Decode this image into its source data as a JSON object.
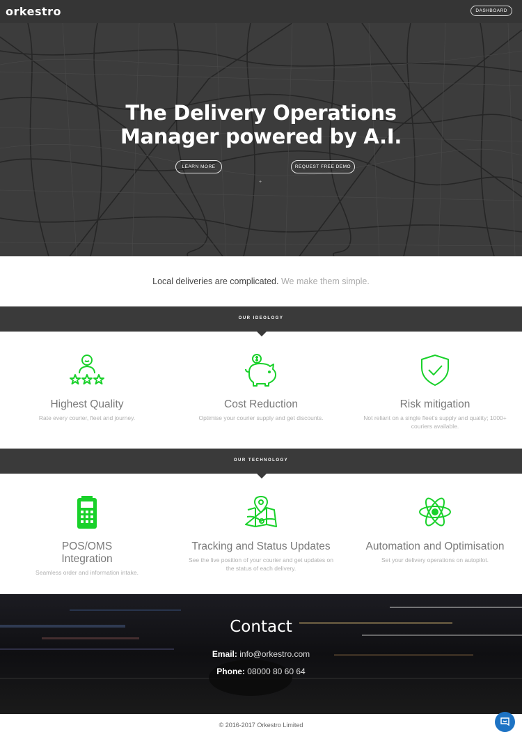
{
  "nav": {
    "logo": "orkestro",
    "dashboard_label": "DASHBOARD"
  },
  "hero": {
    "title_line1": "The Delivery Operations",
    "title_line2": "Manager powered by A.I.",
    "learn_more_label": "LEARN MORE",
    "demo_label": "REQUEST FREE DEMO",
    "dot": "+"
  },
  "tagline": {
    "dark": "Local deliveries are complicated.",
    "light": "We make them simple."
  },
  "ideology": {
    "label": "OUR IDEOLOGY",
    "items": [
      {
        "title": "Highest Quality",
        "desc": "Rate every courier, fleet and journey.",
        "icon": "courier-rating-icon"
      },
      {
        "title": "Cost Reduction",
        "desc": "Optimise your courier supply and get discounts.",
        "icon": "piggy-bank-icon"
      },
      {
        "title": "Risk mitigation",
        "desc": "Not reliant on a single fleet's supply and quality; 1000+ couriers available.",
        "icon": "shield-check-icon"
      }
    ]
  },
  "technology": {
    "label": "OUR TECHNOLOGY",
    "items": [
      {
        "title": "POS/OMS Integration",
        "desc": "Seamless order and information intake.",
        "icon": "pos-terminal-icon"
      },
      {
        "title": "Tracking and Status Updates",
        "desc": "See the live position of your courier and get updates on the status of each delivery.",
        "icon": "map-pin-icon"
      },
      {
        "title": "Automation and Optimisation",
        "desc": "Set your delivery operations on autopilot.",
        "icon": "atom-icon"
      }
    ]
  },
  "contact": {
    "title": "Contact",
    "email_label": "Email:",
    "email": "info@orkestro.com",
    "phone_label": "Phone:",
    "phone": "08000 80 60 64"
  },
  "footer": {
    "copyright": "© 2016-2017 Orkestro Limited"
  },
  "colors": {
    "accent": "#19d12a",
    "band": "#3a3a3a",
    "nav": "#353535",
    "chat": "#1d73c4"
  }
}
